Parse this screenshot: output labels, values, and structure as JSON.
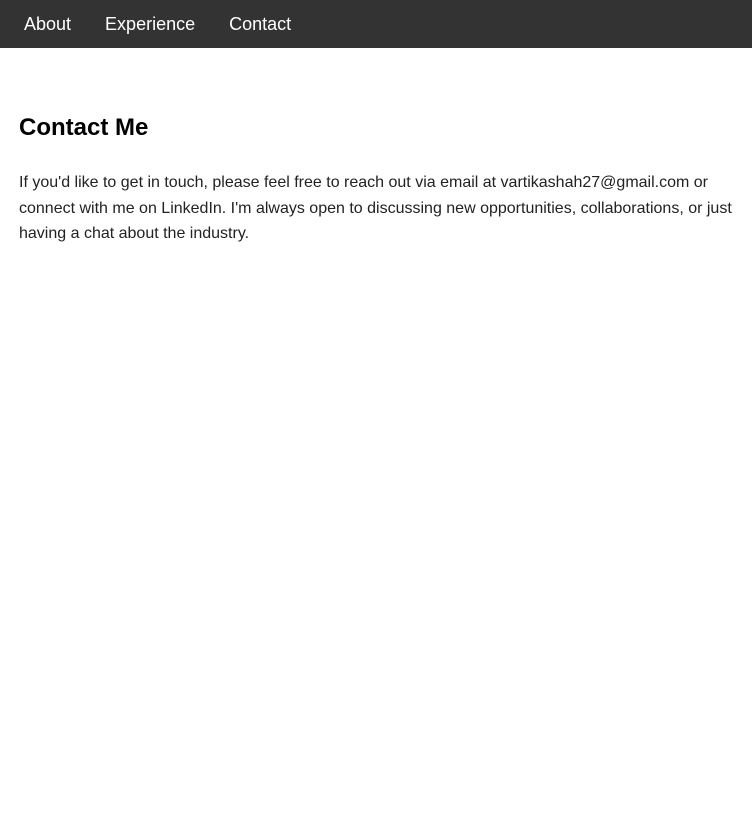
{
  "nav": {
    "items": [
      {
        "label": "About"
      },
      {
        "label": "Experience"
      },
      {
        "label": "Contact"
      }
    ]
  },
  "contact": {
    "title": "Contact Me",
    "body": "If you'd like to get in touch, please feel free to reach out via email at vartikashah27@gmail.com or connect with me on LinkedIn. I'm always open to discussing new opportunities, collaborations, or just having a chat about the industry."
  },
  "colors": {
    "nav_background": "#333333",
    "nav_text": "#ffffff",
    "page_background": "#ffffff"
  }
}
